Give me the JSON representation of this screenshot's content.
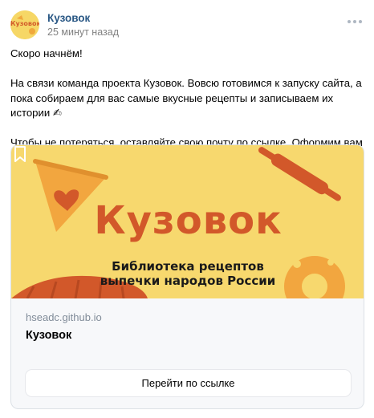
{
  "post": {
    "author": "Кузовок",
    "avatar_text": "Кузовок",
    "time": "25 минут назад",
    "more_icon": "more-horizontal-icon"
  },
  "text": {
    "line1": "Скоро начнём!",
    "line2": "На связи команда проекта Кузовок. Вовсю готовимся к запуску сайта, а пока собираем для вас самые вкусные рецепты и записываем их истории ✍",
    "line3": "Чтобы не потеряться, оставляйте свою почту по ссылке. Оформим вам читательский билетик самым первым!"
  },
  "card": {
    "banner_title": "Кузовок",
    "banner_subtitle": "Библиотека рецептов выпечки народов России",
    "bookmark_icon": "bookmark-icon",
    "domain": "hseadc.github.io",
    "title": "Кузовок",
    "button_label": "Перейти по ссылке"
  },
  "colors": {
    "banner_bg": "#f7d86e",
    "brand_orange": "#d2582a",
    "author_link": "#2a5885"
  }
}
